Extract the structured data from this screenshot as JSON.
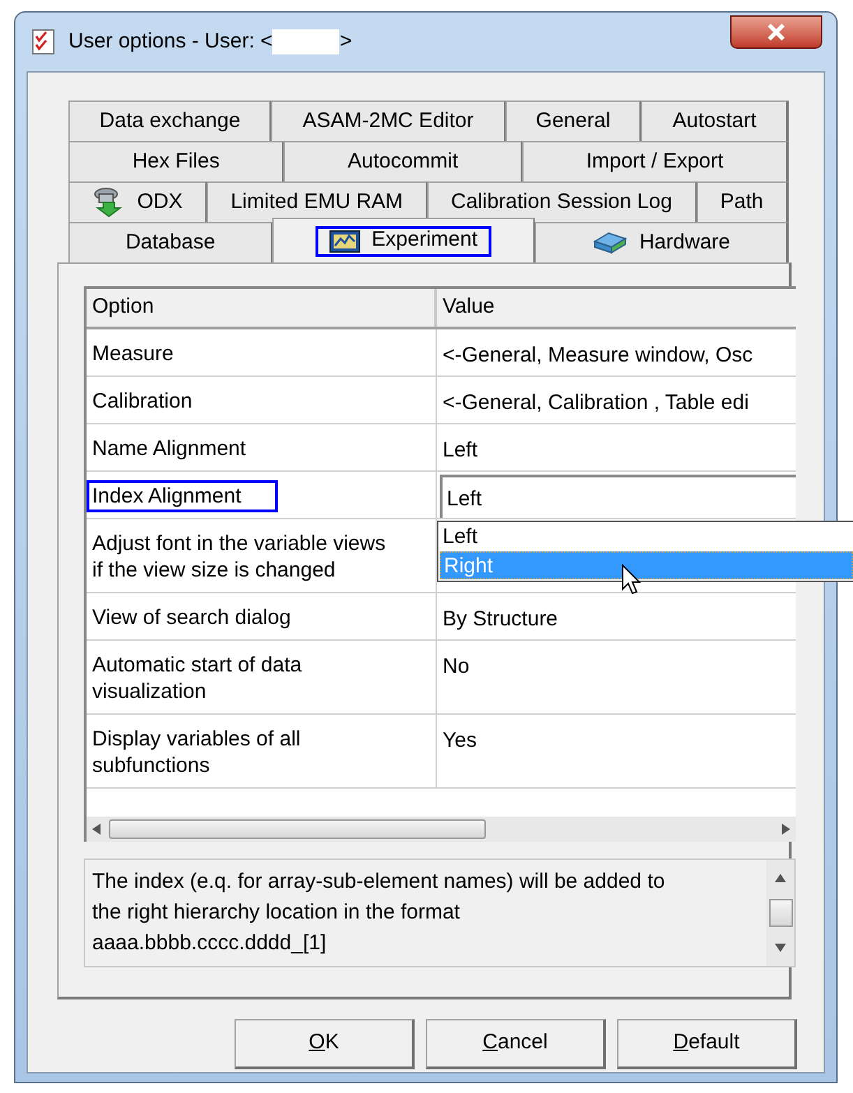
{
  "window": {
    "title": "User options - User: <",
    "title_end": ">"
  },
  "tab_rows": [
    {
      "tabs": [
        {
          "label": "Data exchange",
          "selected": false,
          "focused": false,
          "kind": "plain"
        },
        {
          "label": "ASAM-2MC Editor",
          "selected": false,
          "focused": false,
          "kind": "plain"
        },
        {
          "label": "General",
          "selected": false,
          "focused": false,
          "kind": "plain"
        },
        {
          "label": "Autostart",
          "selected": false,
          "focused": false,
          "kind": "plain"
        }
      ]
    },
    {
      "tabs": [
        {
          "label": "Hex Files",
          "selected": false,
          "focused": false,
          "kind": "plain"
        },
        {
          "label": "Autocommit",
          "selected": false,
          "focused": false,
          "kind": "plain"
        },
        {
          "label": "Import / Export",
          "selected": false,
          "focused": false,
          "kind": "plain"
        }
      ]
    },
    {
      "tabs": [
        {
          "label": "ODX",
          "selected": false,
          "focused": false,
          "kind": "odx"
        },
        {
          "label": "Limited EMU RAM",
          "selected": false,
          "focused": false,
          "kind": "plain"
        },
        {
          "label": "Calibration Session Log",
          "selected": false,
          "focused": false,
          "kind": "plain"
        },
        {
          "label": "Path",
          "selected": false,
          "focused": false,
          "kind": "plain"
        }
      ]
    },
    {
      "tabs": [
        {
          "label": "Database",
          "selected": false,
          "focused": false,
          "kind": "plain"
        },
        {
          "label": "Experiment",
          "selected": true,
          "focused": true,
          "kind": "experiment"
        },
        {
          "label": "Hardware",
          "selected": false,
          "focused": false,
          "kind": "hardware"
        }
      ]
    }
  ],
  "table": {
    "columns": [
      "Option",
      "Value"
    ],
    "rows": [
      {
        "option": "Measure",
        "value": "<-General, Measure window, Osc",
        "kind": "text",
        "focused": false
      },
      {
        "option": "Calibration",
        "value": "<-General, Calibration , Table edi",
        "kind": "text",
        "focused": false
      },
      {
        "option": "Name Alignment",
        "value": "Left",
        "kind": "text",
        "focused": false
      },
      {
        "option": "Index Alignment",
        "value": "Left",
        "kind": "combo",
        "focused": true,
        "dropdown": [
          {
            "label": "Left",
            "highlighted": false
          },
          {
            "label": "Right",
            "highlighted": true
          }
        ]
      },
      {
        "option": "Adjust font in the variable views if the view size is changed",
        "kind": "text",
        "focused": false
      },
      {
        "option": "View of search dialog",
        "value": "By Structure",
        "kind": "text",
        "focused": false
      },
      {
        "option": "Automatic start of data visualization",
        "value": "No",
        "kind": "text",
        "focused": false
      },
      {
        "option": "Display variables of all subfunctions",
        "value": "Yes",
        "kind": "text",
        "focused": false
      }
    ]
  },
  "description": [
    "The index (e.q. for array-sub-element names) will be added to",
    "the right hierarchy location in the format",
    "aaaa.bbbb.cccc.dddd_[1]"
  ],
  "buttons": [
    {
      "mnemonic": "O",
      "rest": "K"
    },
    {
      "mnemonic": "C",
      "rest": "ancel"
    },
    {
      "mnemonic": "D",
      "rest": "efault"
    }
  ]
}
